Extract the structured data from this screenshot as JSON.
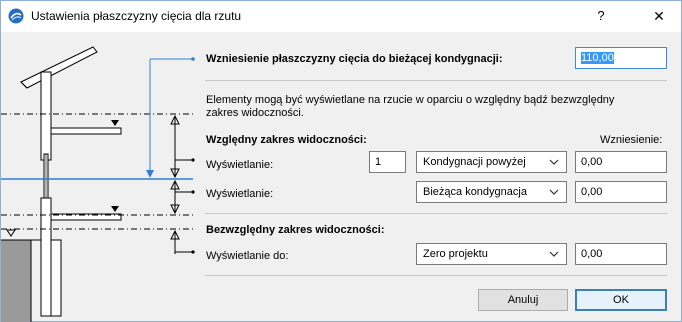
{
  "window": {
    "title": "Ustawienia płaszczyzny cięcia dla rzutu",
    "help_label": "?",
    "close_label": "✕"
  },
  "cut_plane": {
    "label": "Wzniesienie płaszczyzny cięcia do bieżącej kondygnacji:",
    "value": "110,00"
  },
  "description": {
    "line1": "Elementy mogą być wyświetlane na rzucie w oparciu o względny bądź bezwzględny",
    "line2": "zakres widoczności."
  },
  "relative": {
    "heading": "Względny zakres widoczności:",
    "elevation_heading": "Wzniesienie:",
    "top": {
      "label": "Wyświetlanie:",
      "count": "1",
      "selected": "Kondygnacji powyżej",
      "elevation": "0,00"
    },
    "bottom": {
      "label": "Wyświetlanie:",
      "selected": "Bieżąca kondygnacja",
      "elevation": "0,00"
    }
  },
  "absolute": {
    "heading": "Bezwzględny zakres widoczności:",
    "label": "Wyświetlanie do:",
    "selected": "Zero projektu",
    "elevation": "0,00"
  },
  "buttons": {
    "cancel": "Anuluj",
    "ok": "OK"
  },
  "colors": {
    "accent_blue": "#2f7fd6",
    "selection": "#3399ff"
  },
  "icons": [
    "app-icon",
    "help-icon",
    "close-icon",
    "chevron-down-icon"
  ]
}
